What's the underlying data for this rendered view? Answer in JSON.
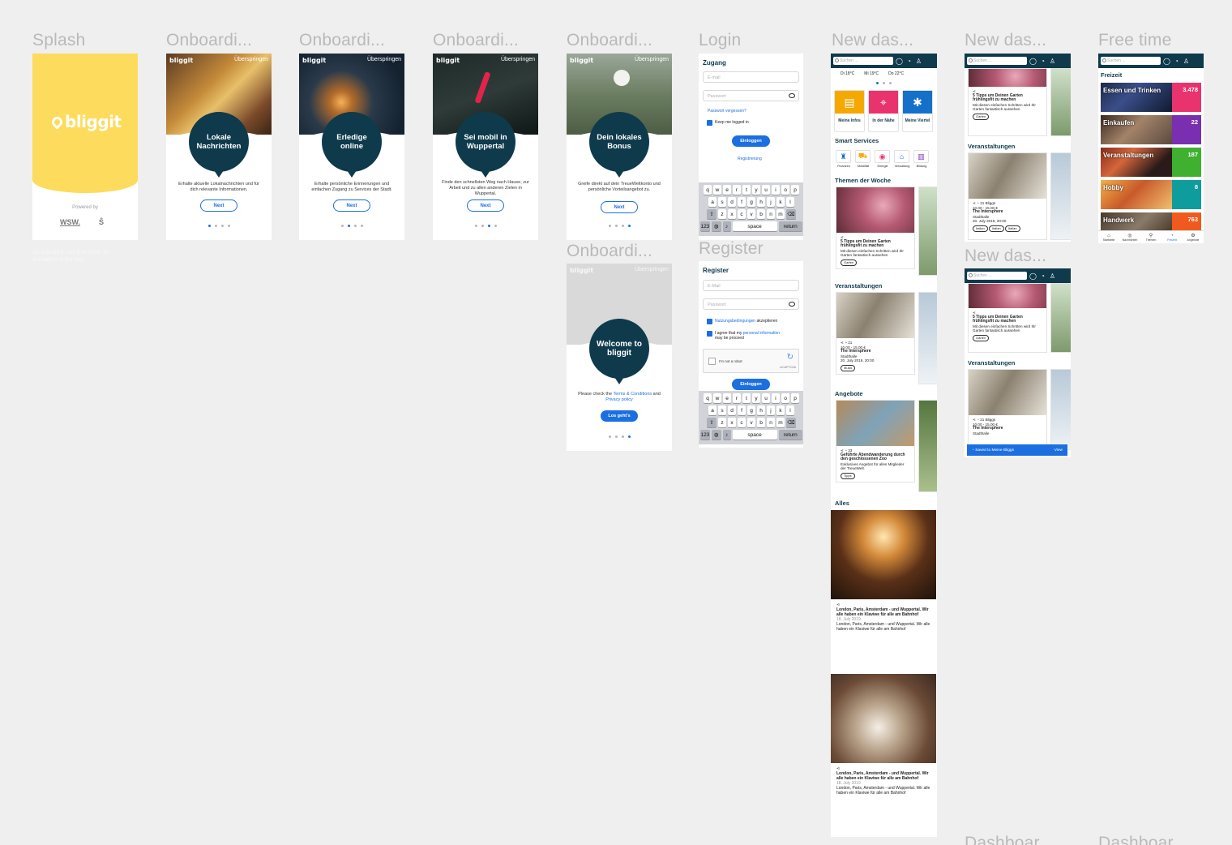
{
  "frames": {
    "splash": "Splash",
    "onboarding": "Onboardi...",
    "login": "Login",
    "register": "Register",
    "new_dashboard": "New das...",
    "free_time": "Free time",
    "dashboard_cut": "Dashboar"
  },
  "splash": {
    "logo": "bliggit",
    "powered_by": "Powered by",
    "sponsor_1": "WSW.",
    "sponsor_2": "Ŝ",
    "note": "An animation will first make an animation of the logo"
  },
  "onboarding": {
    "logo": "bliggit",
    "skip": "Überspringen",
    "next": "Next",
    "pages": [
      {
        "title": "Lokale Nachrichten",
        "text": "Erhalte aktuelle Lokalnachrichten und für dich relevante Informationen."
      },
      {
        "title": "Erledige online",
        "text": "Erhalte persönliche Erinnerungen und einfachen Zugang zu Services der Stadt."
      },
      {
        "title": "Sei mobil in Wuppertal",
        "text": "Finde den schnellsten Weg nach Hause, zur Arbeit und zu allen anderen Zielen in Wuppertal."
      },
      {
        "title": "Dein lokales Bonus",
        "text": "Greife direkt auf dein TreueWeltkonto und persönliche Vorteilsangebot zu."
      }
    ],
    "welcome": {
      "title": "Welcome to bliggit",
      "text_before": "Please check the",
      "terms": "Terms & Conditions",
      "and": "and",
      "privacy": "Privacy policy",
      "cta": "Los geht's"
    }
  },
  "login": {
    "heading": "Zugang",
    "email_placeholder": "E-mail",
    "password_placeholder": "Passwort",
    "forgot": "Passwort vergessen?",
    "keep_logged": "Keep me logged in",
    "submit": "Einloggen",
    "register_link": "Registrierung"
  },
  "register": {
    "heading": "Register",
    "email_placeholder": "E-Mail",
    "password_placeholder": "Passwort",
    "terms_link": "Nutzungsbedingungen",
    "terms_suffix": "akzeptieren",
    "consent_prefix": "I agree that my",
    "consent_link": "personal information",
    "consent_suffix": "may be proceed",
    "captcha": "I'm not a robot",
    "captcha_brand": "reCAPTCHA",
    "submit": "Einloggen"
  },
  "keyboard": {
    "row1": [
      "q",
      "w",
      "e",
      "r",
      "t",
      "y",
      "u",
      "i",
      "o",
      "p"
    ],
    "row2": [
      "a",
      "s",
      "d",
      "f",
      "g",
      "h",
      "j",
      "k",
      "l"
    ],
    "row3": [
      "z",
      "x",
      "c",
      "v",
      "b",
      "n",
      "m"
    ],
    "numbers": "123",
    "space": "space",
    "return": "return"
  },
  "dashboard": {
    "search_placeholder": "Suchen ...",
    "weather": [
      "Di 18°C",
      "Mi 19°C",
      "Do 22°C"
    ],
    "tiles": [
      {
        "label": "Meine Infos",
        "color": "#f5a800"
      },
      {
        "label": "In der Nähe",
        "color": "#e8336e"
      },
      {
        "label": "Meine Viertel",
        "color": "#1570c9"
      }
    ],
    "smart_services": "Smart Services",
    "services": [
      "Finanzen",
      "Mobilität",
      "Energie",
      "Verwaltung",
      "Bildung"
    ],
    "themen": "Themen der Woche",
    "article_title": "5 Tipps um Deinen Garten frühlingsfit zu machen",
    "article_text": "Mit diesen einfachen Schritten wird Ihr Garten fantastisch aussehen",
    "tag_garten": "Garten",
    "veranstaltungen": "Veranstaltungen",
    "event_price": "10.00 - 15.00 €",
    "event_title": "The Intersphere",
    "event_place": "Stadthalle",
    "event_date": "20. July 2019, 20:00",
    "event_count": "21",
    "event_count_b": "21 Bliggs",
    "tag_musik": "Musik",
    "tag_italian": "Italian",
    "angebote": "Angebote",
    "offer_title": "Geführte Abendwanderung durch den geschlossenen Zoo",
    "offer_text": "Exklusives Angebot für alles Mitglieder der TreueWelt.",
    "offer_count": "33",
    "tag_tipps": "Tipps",
    "alles": "Alles",
    "news_title": "London, Paris, Amsterdam - und Wuppertal. Wir alle haben ein Klaviwe für alle am Bahnhof",
    "news_date": "18. July 2019",
    "news_text": "London, Paris, Amsterdam - und Wuppertal. Wir alle haben ein Klaviwe für alle am Bahnhof",
    "toast": "Saved to Meine Bliggs",
    "toast_action": "View"
  },
  "free_time": {
    "heading": "Freizeit",
    "categories": [
      {
        "name": "Essen und Trinken",
        "count": "3.478",
        "color": "#e8336e"
      },
      {
        "name": "Einkaufen",
        "count": "22",
        "color": "#7a2fb0"
      },
      {
        "name": "Veranstaltungen",
        "count": "187",
        "color": "#3fb02f"
      },
      {
        "name": "Hobby",
        "count": "8",
        "color": "#0f9c9c"
      },
      {
        "name": "Handwerk",
        "count": "763",
        "color": "#f15a1e"
      }
    ],
    "nav": [
      "Startseite",
      "Nachrichten",
      "Themen",
      "Freizeit",
      "Angebote"
    ]
  }
}
